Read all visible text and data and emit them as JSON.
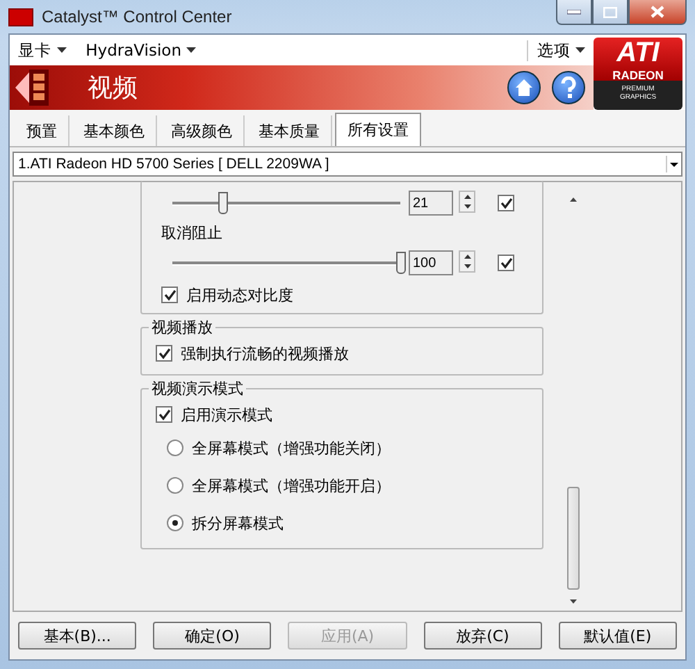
{
  "window": {
    "title": "Catalyst™ Control Center"
  },
  "menu": [
    {
      "label": "显卡"
    },
    {
      "label": "HydraVision"
    }
  ],
  "options_menu": {
    "label": "选项"
  },
  "header": {
    "title": "视频"
  },
  "logo": {
    "brand": "ATI",
    "line": "RADEON",
    "tagline": "PREMIUM GRAPHICS"
  },
  "tabs": [
    {
      "label": "预置",
      "selected": false
    },
    {
      "label": "基本颜色",
      "selected": false
    },
    {
      "label": "高级颜色",
      "selected": false
    },
    {
      "label": "基本质量",
      "selected": false
    },
    {
      "label": "所有设置",
      "selected": true
    }
  ],
  "device_select": {
    "value": "1.ATI Radeon HD 5700 Series [ DELL 2209WA ]"
  },
  "top_group": {
    "items": [
      {
        "kind": "slider",
        "level": 0.22,
        "value": "21",
        "checked": true
      },
      {
        "kind": "label",
        "text": "取消阻止"
      },
      {
        "kind": "slider",
        "level": 1.0,
        "value": "100",
        "checked": true
      },
      {
        "kind": "checkbox",
        "label": "启用动态对比度",
        "checked": true
      }
    ]
  },
  "groups": [
    {
      "title": "视频播放",
      "items": [
        {
          "kind": "checkbox",
          "label": "强制执行流畅的视频播放",
          "checked": true
        }
      ]
    },
    {
      "title": "视频演示模式",
      "items": [
        {
          "kind": "checkbox",
          "label": "启用演示模式",
          "checked": true
        },
        {
          "kind": "radio",
          "label": "全屏幕模式（增强功能关闭）",
          "selected": false
        },
        {
          "kind": "radio",
          "label": "全屏幕模式（增强功能开启）",
          "selected": false
        },
        {
          "kind": "radio",
          "label": "拆分屏幕模式",
          "selected": true
        }
      ]
    }
  ],
  "buttons": [
    {
      "label": "基本(B)...",
      "disabled": false
    },
    {
      "label": "确定(O)",
      "disabled": false
    },
    {
      "label": "应用(A)",
      "disabled": true
    },
    {
      "label": "放弃(C)",
      "disabled": false
    },
    {
      "label": "默认值(E)",
      "disabled": false
    }
  ]
}
